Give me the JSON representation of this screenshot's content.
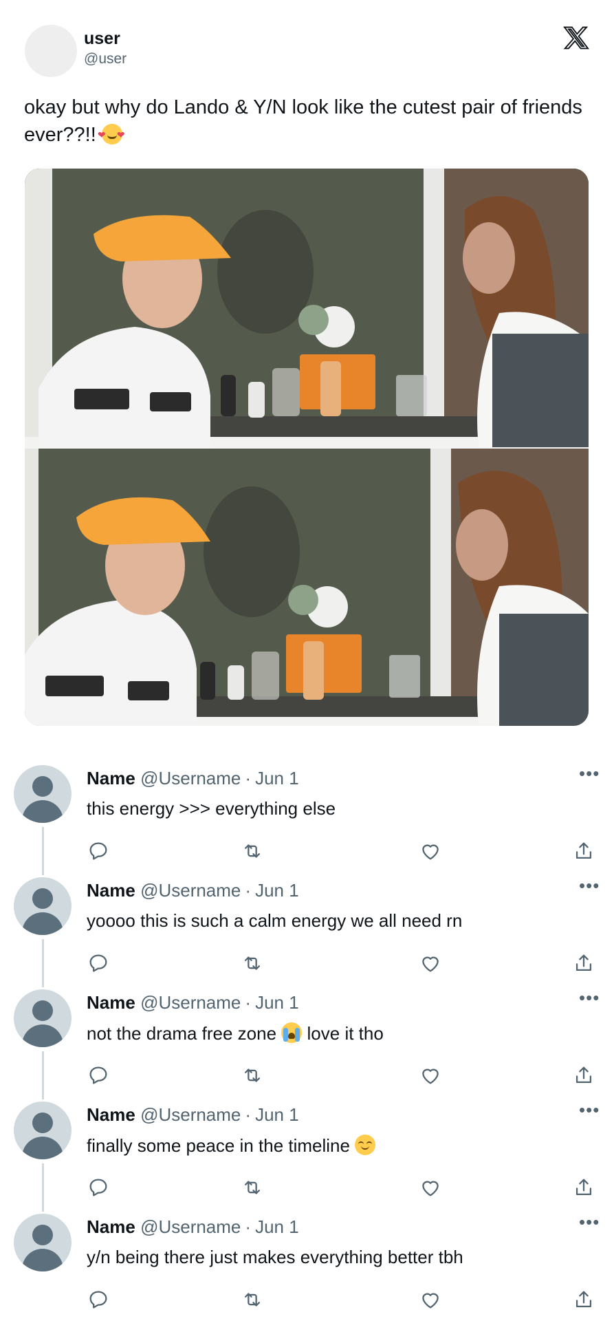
{
  "author": {
    "display_name": "user",
    "handle": "@user"
  },
  "logo_icon": "x-logo-icon",
  "tweet": {
    "text": "okay but why do Lando & Y/N look like the cutest pair of friends ever??!!",
    "emoji": "smiling-face-with-hearts"
  },
  "media": {
    "count": 2,
    "icon": "photo"
  },
  "replies": [
    {
      "name": "Name",
      "username": "@Username",
      "separator": "·",
      "date": "Jun 1",
      "text": "this energy >>> everything else",
      "emoji": ""
    },
    {
      "name": "Name",
      "username": "@Username",
      "separator": "·",
      "date": "Jun 1",
      "text": "yoooo this is such a calm energy we all need rn",
      "emoji": ""
    },
    {
      "name": "Name",
      "username": "@Username",
      "separator": "·",
      "date": "Jun 1",
      "text_before": "not the drama free zone",
      "text_after": "love it tho",
      "emoji": "loudly-crying-face"
    },
    {
      "name": "Name",
      "username": "@Username",
      "separator": "·",
      "date": "Jun 1",
      "text": "finally some peace in the timeline",
      "emoji": "relieved-face"
    },
    {
      "name": "Name",
      "username": "@Username",
      "separator": "·",
      "date": "Jun 1",
      "text": "y/n being there just makes everything better tbh",
      "emoji": ""
    }
  ],
  "reply_actions": [
    "reply-icon",
    "retweet-icon",
    "like-icon",
    "share-icon"
  ],
  "more_label": "•••",
  "colors": {
    "text": "#0f1419",
    "muted": "#536471",
    "avatar_placeholder": "#cfd9de",
    "avatar_figure": "#5b6f7c",
    "cap_orange": "#f5a53a"
  }
}
